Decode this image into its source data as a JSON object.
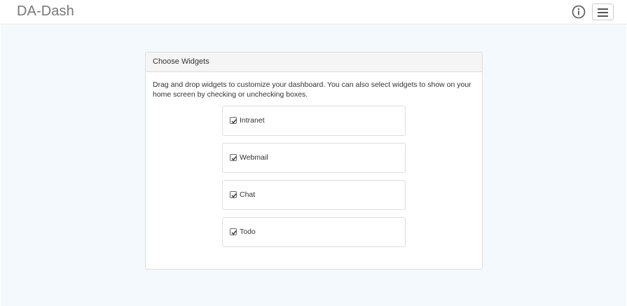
{
  "navbar": {
    "brand": "DA-Dash",
    "info_icon": "info-circle-icon",
    "menu_icon": "hamburger-menu-icon"
  },
  "panel": {
    "heading": "Choose Widgets",
    "description": "Drag and drop widgets to customize your dashboard. You can also select widgets to show on your home screen by checking or unchecking boxes.",
    "widgets": [
      {
        "label": "Intranet",
        "checked": true
      },
      {
        "label": "Webmail",
        "checked": true
      },
      {
        "label": "Chat",
        "checked": true
      },
      {
        "label": "Todo",
        "checked": true
      }
    ]
  },
  "colors": {
    "background": "#f4f9fd",
    "brand_text": "#777777",
    "panel_heading_bg": "#f5f5f5",
    "border": "#dddddd"
  }
}
